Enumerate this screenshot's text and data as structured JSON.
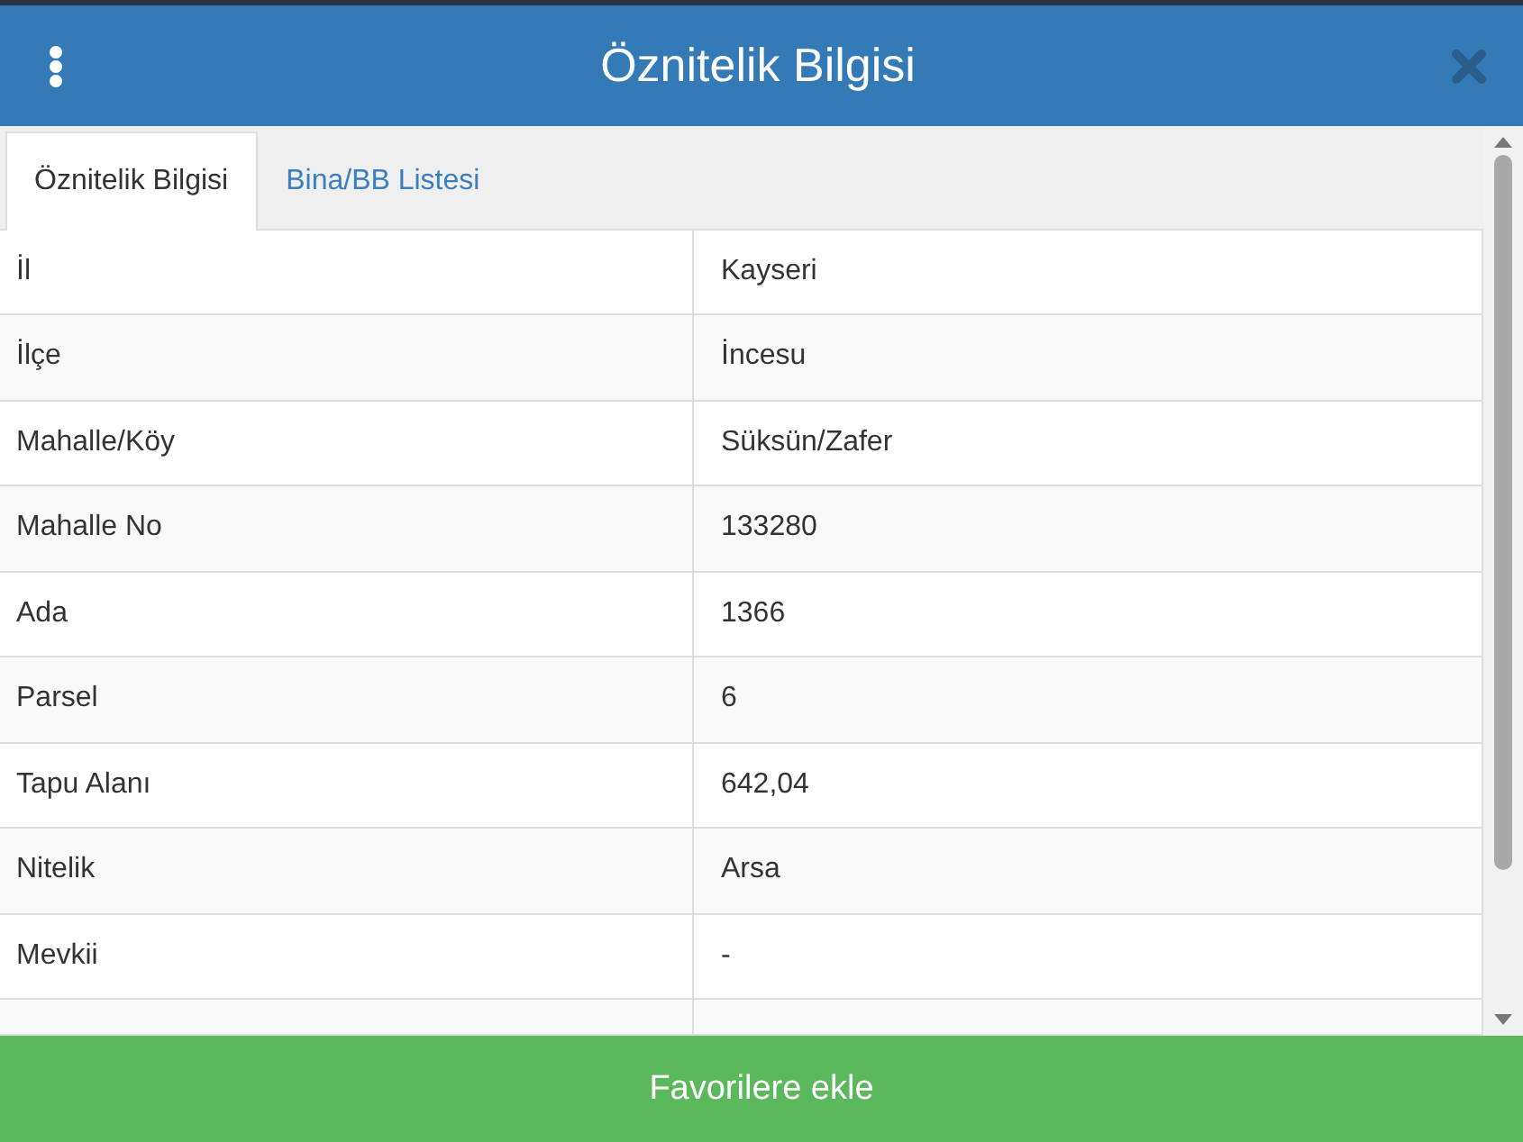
{
  "header": {
    "title": "Öznitelik Bilgisi"
  },
  "tabs": [
    {
      "label": "Öznitelik Bilgisi",
      "selected": true
    },
    {
      "label": "Bina/BB Listesi",
      "selected": false
    }
  ],
  "rows": [
    {
      "label": "İl",
      "value": "Kayseri"
    },
    {
      "label": "İlçe",
      "value": "İncesu"
    },
    {
      "label": "Mahalle/Köy",
      "value": "Süksün/Zafer"
    },
    {
      "label": "Mahalle No",
      "value": "133280"
    },
    {
      "label": "Ada",
      "value": "1366"
    },
    {
      "label": "Parsel",
      "value": "6"
    },
    {
      "label": "Tapu Alanı",
      "value": "642,04"
    },
    {
      "label": "Nitelik",
      "value": "Arsa"
    },
    {
      "label": "Mevkii",
      "value": "-"
    }
  ],
  "footer_button": "Favorilere ekle"
}
